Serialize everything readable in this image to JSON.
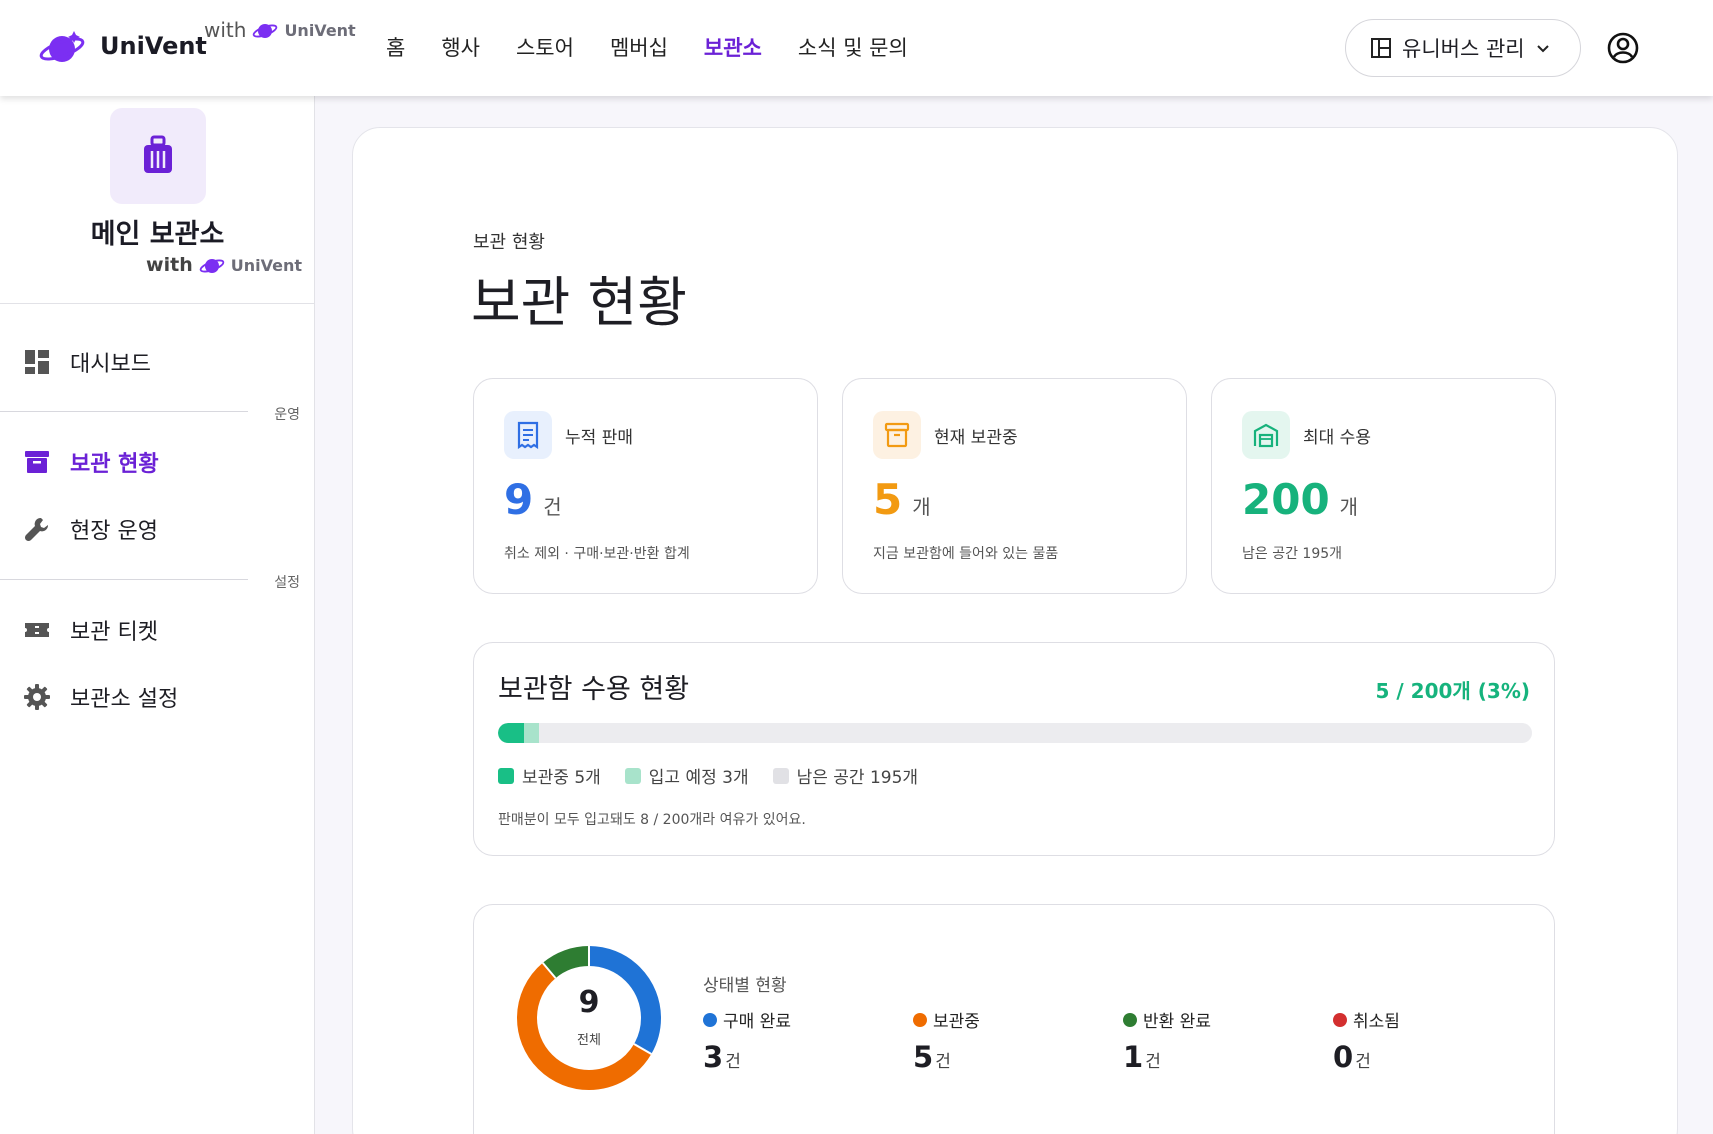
{
  "header": {
    "brand": "UniVent",
    "with_label": "with",
    "with_brand": "UniVent",
    "nav": [
      {
        "label": "홈",
        "active": false
      },
      {
        "label": "행사",
        "active": false
      },
      {
        "label": "스토어",
        "active": false
      },
      {
        "label": "멤버십",
        "active": false
      },
      {
        "label": "보관소",
        "active": true
      },
      {
        "label": "소식 및 문의",
        "active": false
      }
    ],
    "manage_button": "유니버스 관리"
  },
  "sidebar": {
    "store_name": "메인 보관소",
    "with_label": "with",
    "with_brand": "UniVent",
    "items": [
      {
        "label": "대시보드",
        "icon": "dashboard-icon"
      },
      {
        "label": "보관 현황",
        "icon": "archive-icon",
        "active": true
      },
      {
        "label": "현장 운영",
        "icon": "wrench-icon"
      },
      {
        "label": "보관 티켓",
        "icon": "ticket-icon"
      },
      {
        "label": "보관소 설정",
        "icon": "gear-icon"
      }
    ],
    "sections": [
      "운영",
      "설정"
    ]
  },
  "main": {
    "breadcrumb": "보관 현황",
    "title": "보관 현황",
    "stats": [
      {
        "title": "누적 판매",
        "value": "9",
        "unit": "건",
        "desc": "취소 제외 · 구매·보관·반환 합계",
        "color": "#2f6fe4",
        "icon": "receipt-icon"
      },
      {
        "title": "현재 보관중",
        "value": "5",
        "unit": "개",
        "desc": "지금 보관함에 들어와 있는 물품",
        "color": "#f29a12",
        "icon": "archive-box-icon"
      },
      {
        "title": "최대 수용",
        "value": "200",
        "unit": "개",
        "desc": "남은 공간 195개",
        "color": "#17b27c",
        "icon": "warehouse-icon"
      }
    ],
    "capacity": {
      "title": "보관함 수용 현황",
      "ratio": "5 / 200개 (3%)",
      "stored": 5,
      "incoming": 3,
      "total": 200,
      "legend": [
        {
          "label": "보관중 5개",
          "color": "#19bf86"
        },
        {
          "label": "입고 예정 3개",
          "color": "#a8e3cb"
        },
        {
          "label": "남은 공간 195개",
          "color": "#e1e1e5"
        }
      ],
      "note": "판매분이 모두 입고돼도 8 / 200개라 여유가 있어요."
    },
    "status": {
      "heading": "상태별 현황",
      "total": "9",
      "total_label": "전체",
      "items": [
        {
          "name": "구매 완료",
          "count": 3,
          "unit": "건",
          "color": "#1f73d6"
        },
        {
          "name": "보관중",
          "count": 5,
          "unit": "건",
          "color": "#ef6c00"
        },
        {
          "name": "반환 완료",
          "count": 1,
          "unit": "건",
          "color": "#2e7d32"
        },
        {
          "name": "취소됨",
          "count": 0,
          "unit": "건",
          "color": "#d32f2f"
        }
      ]
    }
  }
}
